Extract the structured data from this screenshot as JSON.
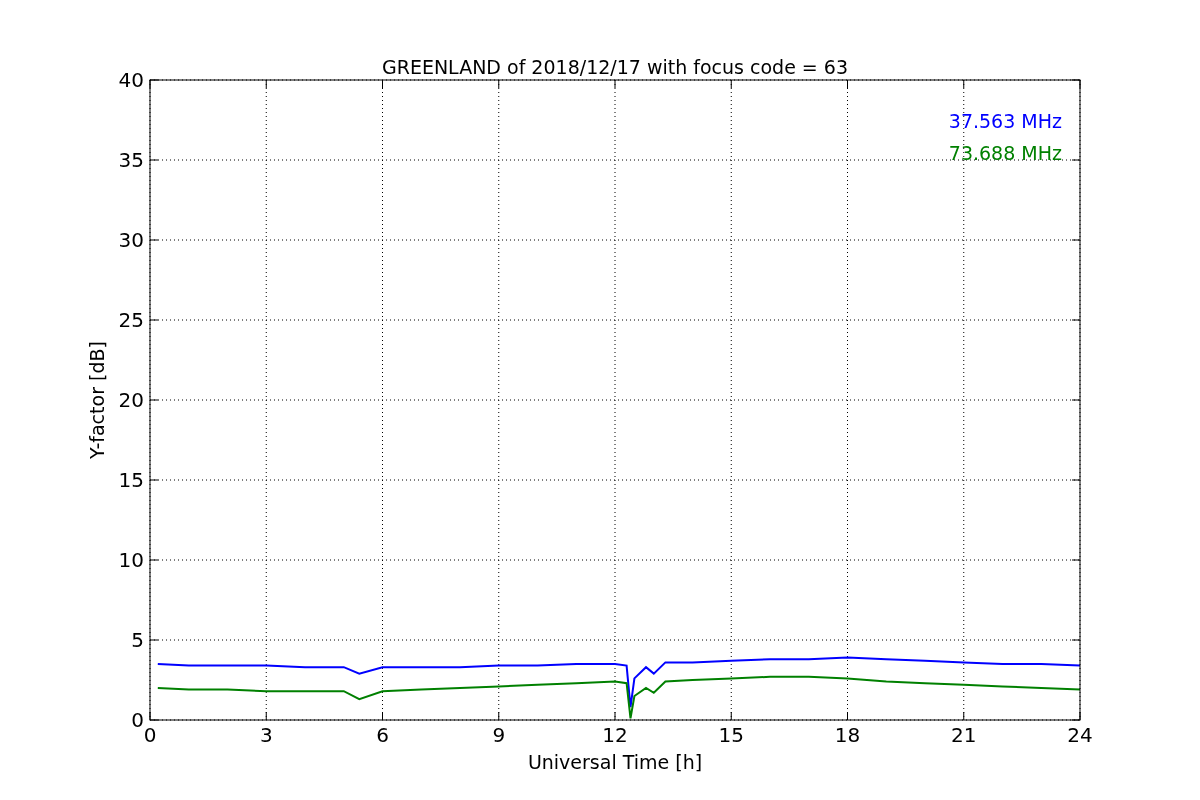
{
  "chart_data": {
    "type": "line",
    "title": "GREENLAND of 2018/12/17 with focus code = 63",
    "xlabel": "Universal Time [h]",
    "ylabel": "Y-factor [dB]",
    "x": [
      0.2,
      1,
      2,
      3,
      4,
      5,
      5.4,
      6,
      7,
      8,
      9,
      10,
      11,
      12,
      12.3,
      12.4,
      12.5,
      12.8,
      13,
      13.3,
      14,
      15,
      16,
      17,
      18,
      19,
      20,
      21,
      22,
      23,
      24
    ],
    "series": [
      {
        "name": "37.563 MHz",
        "color": "#0000ff",
        "values": [
          3.5,
          3.4,
          3.4,
          3.4,
          3.3,
          3.3,
          2.9,
          3.3,
          3.3,
          3.3,
          3.4,
          3.4,
          3.5,
          3.5,
          3.4,
          0.8,
          2.6,
          3.3,
          2.9,
          3.6,
          3.6,
          3.7,
          3.8,
          3.8,
          3.9,
          3.8,
          3.7,
          3.6,
          3.5,
          3.5,
          3.4
        ]
      },
      {
        "name": "73.688 MHz",
        "color": "#008000",
        "values": [
          2.0,
          1.9,
          1.9,
          1.8,
          1.8,
          1.8,
          1.3,
          1.8,
          1.9,
          2.0,
          2.1,
          2.2,
          2.3,
          2.4,
          2.3,
          0.1,
          1.5,
          2.0,
          1.7,
          2.4,
          2.5,
          2.6,
          2.7,
          2.7,
          2.6,
          2.4,
          2.3,
          2.2,
          2.1,
          2.0,
          1.9
        ]
      }
    ],
    "xlim": [
      0,
      24
    ],
    "ylim": [
      0,
      40
    ],
    "xticks": [
      0,
      3,
      6,
      9,
      12,
      15,
      18,
      21,
      24
    ],
    "yticks": [
      0,
      5,
      10,
      15,
      20,
      25,
      30,
      35,
      40
    ],
    "grid": true
  }
}
